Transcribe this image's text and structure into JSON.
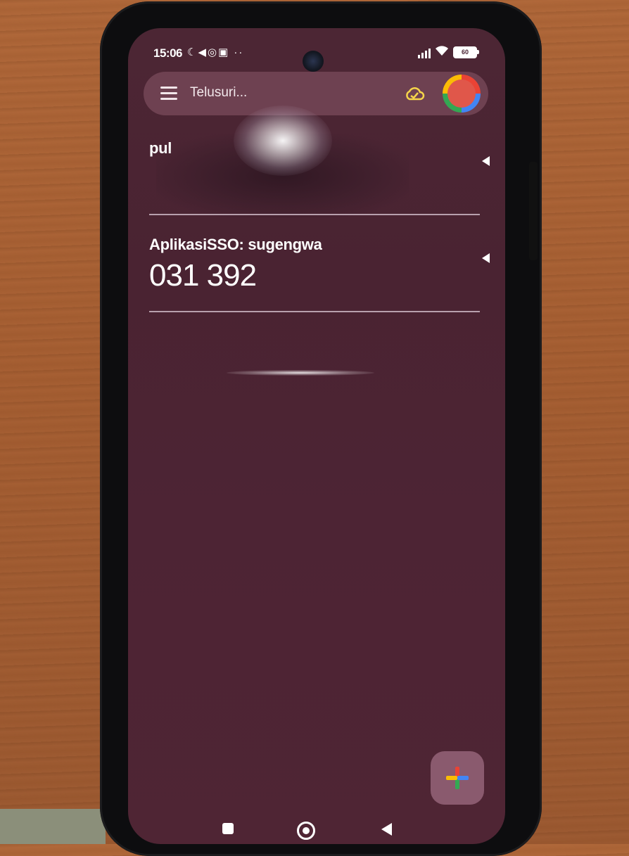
{
  "status_bar": {
    "time": "15:06",
    "left_icons": [
      "moon-icon",
      "telegram-icon",
      "whatsapp-icon",
      "instagram-icon"
    ],
    "left_icons_glyphs": "☾◀◎▣ ··",
    "battery": "60"
  },
  "search": {
    "placeholder": "Telusuri..."
  },
  "accounts": [
    {
      "title": "pul",
      "code": ""
    },
    {
      "title": "AplikasiSSO: sugengwa",
      "code": "031 392"
    }
  ],
  "colors": {
    "screen_background": "#4a2332",
    "search_bar": "#6e4151",
    "fab": "#8a5a6e"
  }
}
